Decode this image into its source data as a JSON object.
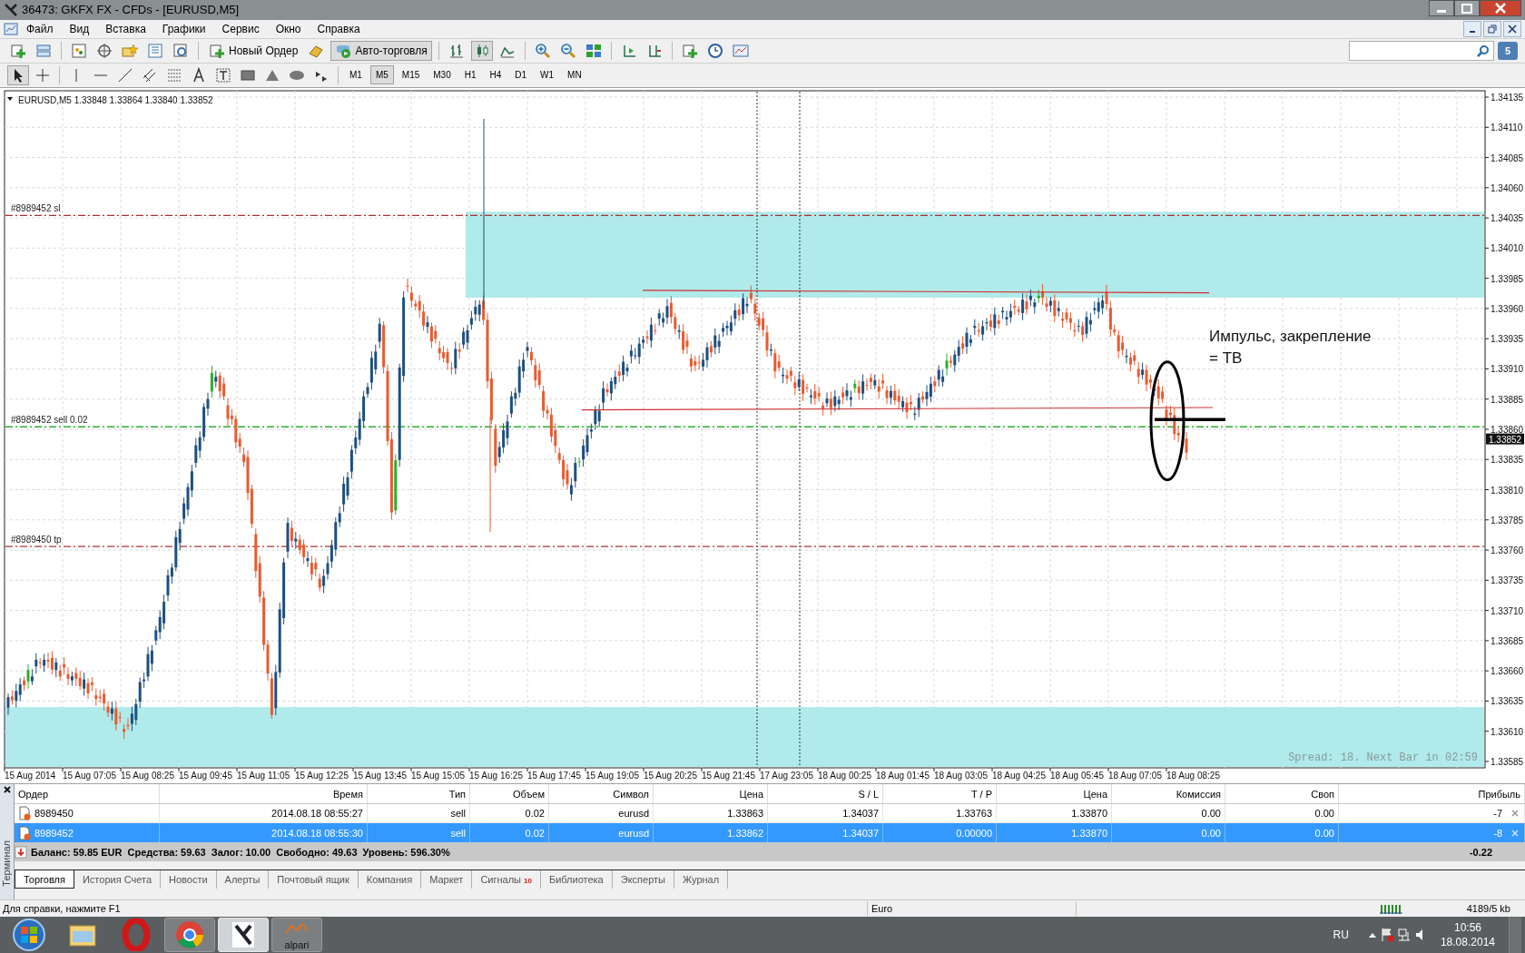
{
  "window": {
    "title": "36473: GKFX FX - CFDs - [EURUSD,M5]"
  },
  "menu": [
    "Файл",
    "Вид",
    "Вставка",
    "Графики",
    "Сервис",
    "Окно",
    "Справка"
  ],
  "toolbar": {
    "new_order": "Новый Ордер",
    "auto_trading": {
      "label": "Авто-торговля",
      "on": true
    },
    "messages_count": "5"
  },
  "timeframes": [
    {
      "label": "M1",
      "selected": false
    },
    {
      "label": "M5",
      "selected": true
    },
    {
      "label": "M15",
      "selected": false
    },
    {
      "label": "M30",
      "selected": false
    },
    {
      "label": "H1",
      "selected": false
    },
    {
      "label": "H4",
      "selected": false
    },
    {
      "label": "D1",
      "selected": false
    },
    {
      "label": "W1",
      "selected": false
    },
    {
      "label": "MN",
      "selected": false
    }
  ],
  "chart": {
    "header": "EURUSD,M5  1.33848 1.33864 1.33840 1.33852",
    "price_labels": [
      "1.34135",
      "1.34110",
      "1.34085",
      "1.34060",
      "1.34035",
      "1.34010",
      "1.33985",
      "1.33960",
      "1.33935",
      "1.33910",
      "1.33885",
      "1.33860",
      "1.33835",
      "1.33810",
      "1.33785",
      "1.33760",
      "1.33735",
      "1.33710",
      "1.33685",
      "1.33660",
      "1.33635",
      "1.33610",
      "1.33585"
    ],
    "current_price": "1.33852",
    "time_labels": [
      "15 Aug 2014",
      "15 Aug 07:05",
      "15 Aug 08:25",
      "15 Aug 09:45",
      "15 Aug 11:05",
      "15 Aug 12:25",
      "15 Aug 13:45",
      "15 Aug 15:05",
      "15 Aug 16:25",
      "15 Aug 17:45",
      "15 Aug 19:05",
      "15 Aug 20:25",
      "15 Aug 21:45",
      "17 Aug 23:05",
      "18 Aug 00:25",
      "18 Aug 01:45",
      "18 Aug 03:05",
      "18 Aug 04:25",
      "18 Aug 05:45",
      "18 Aug 07:05",
      "18 Aug 08:25"
    ],
    "order_lines": [
      {
        "label": "#8989452 sl",
        "kind": "sl"
      },
      {
        "label": "#8989452 sell 0.02",
        "kind": "entry"
      },
      {
        "label": "#8989450 tp",
        "kind": "tp"
      }
    ],
    "annotation": [
      "Импульс, закрепление",
      "= ТВ"
    ],
    "spread_info": "Spread: 18. Next Bar in 02:59"
  },
  "terminal": {
    "side_label": "Терминал",
    "columns": [
      "Ордер",
      "Время",
      "Тип",
      "Объем",
      "Символ",
      "Цена",
      "S / L",
      "T / P",
      "Цена",
      "Комиссия",
      "Своп",
      "Прибыль"
    ],
    "rows": [
      {
        "cells": [
          "8989450",
          "2014.08.18 08:55:27",
          "sell",
          "0.02",
          "eurusd",
          "1.33863",
          "1.34037",
          "1.33763",
          "1.33870",
          "0.00",
          "0.00",
          "-7"
        ],
        "selected": false
      },
      {
        "cells": [
          "8989452",
          "2014.08.18 08:55:30",
          "sell",
          "0.02",
          "eurusd",
          "1.33862",
          "1.34037",
          "0.00000",
          "1.33870",
          "0.00",
          "0.00",
          "-8"
        ],
        "selected": true
      }
    ],
    "balance": "Баланс: 59.85 EUR  Средства: 59.63  Залог: 10.00  Свободно: 49.63  Уровень: 596.30%",
    "total_profit": "-0.22",
    "tabs": [
      {
        "label": "Торговля",
        "selected": true
      },
      {
        "label": "История Счета",
        "selected": false
      },
      {
        "label": "Новости",
        "selected": false
      },
      {
        "label": "Алерты",
        "selected": false
      },
      {
        "label": "Почтовый ящик",
        "selected": false
      },
      {
        "label": "Компания",
        "selected": false
      },
      {
        "label": "Маркет",
        "selected": false
      },
      {
        "label": "Сигналы",
        "badge": "10",
        "selected": false
      },
      {
        "label": "Библиотека",
        "selected": false
      },
      {
        "label": "Эксперты",
        "selected": false
      },
      {
        "label": "Журнал",
        "selected": false
      }
    ]
  },
  "status_bar": {
    "help": "Для справки, нажмите F1",
    "profile": "Euro",
    "traffic": "4189/5 kb"
  },
  "taskbar": {
    "apps": [
      {
        "kind": "start"
      },
      {
        "kind": "folder"
      },
      {
        "kind": "opera"
      },
      {
        "kind": "chrome"
      },
      {
        "kind": "terminal",
        "selected": true
      },
      {
        "kind": "alpari",
        "label": "alpari"
      }
    ],
    "language": "RU",
    "time": "10:56",
    "date": "18.08.2014"
  }
}
